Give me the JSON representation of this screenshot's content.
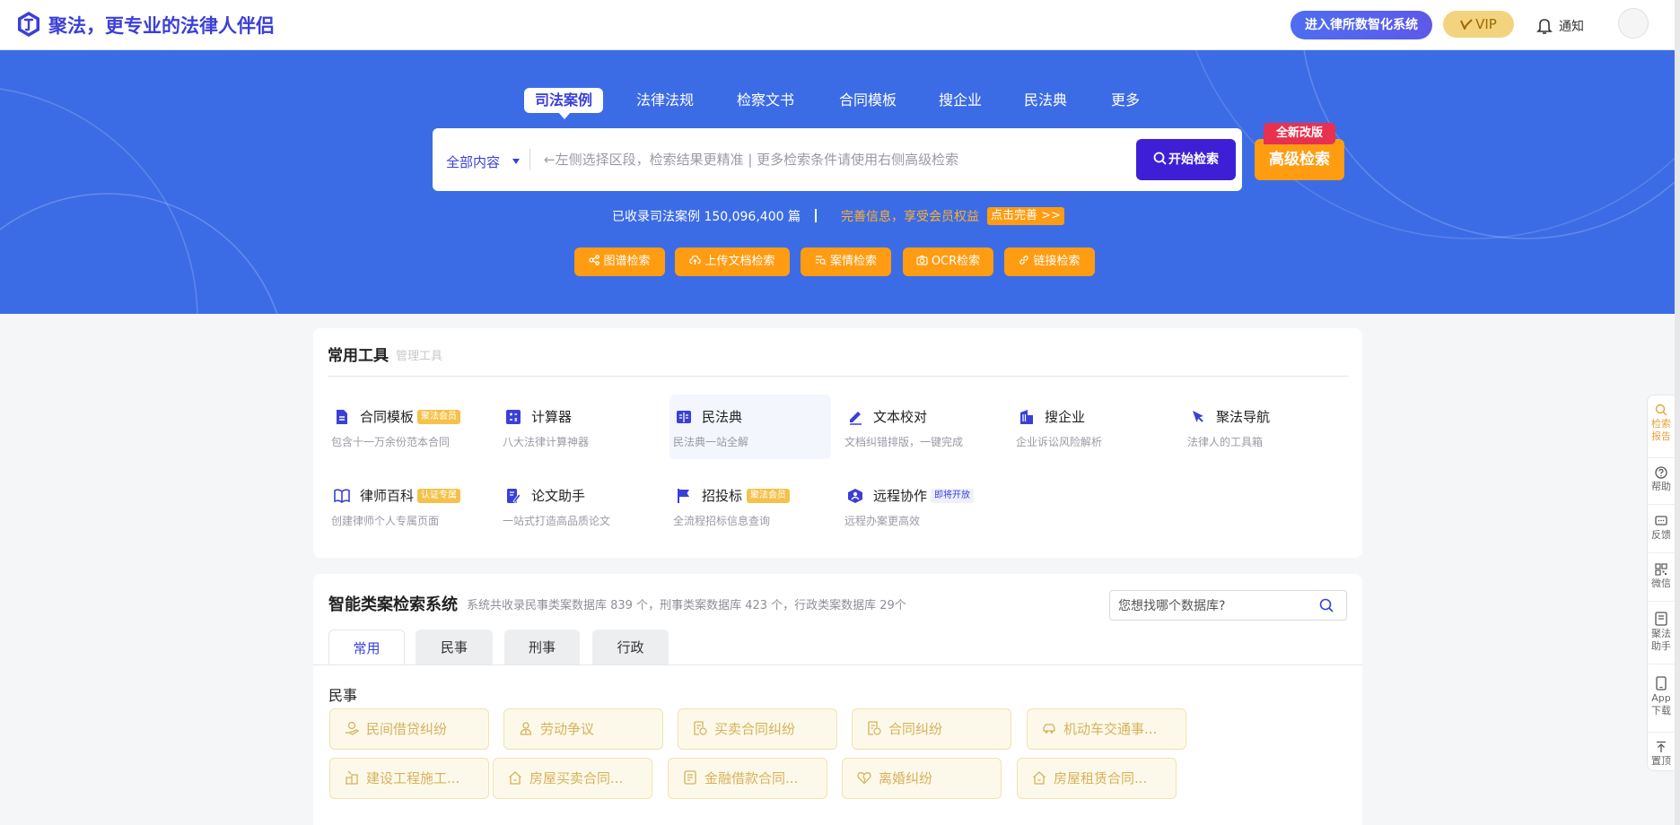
{
  "header": {
    "slogan": "聚法，更专业的法律人伴侣",
    "enter_system": "进入律所数智化系统",
    "vip": "VIP",
    "notify": "通知"
  },
  "nav_tabs": [
    "司法案例",
    "法律法规",
    "检察文书",
    "合同模板",
    "搜企业",
    "民法典",
    "更多"
  ],
  "search": {
    "scope": "全部内容",
    "placeholder": "←左侧选择区段，检索结果更精准 | 更多检索条件请使用右侧高级检索",
    "start": "开始检索",
    "advanced": "高级检索",
    "new_badge": "全新改版"
  },
  "stats": {
    "count_text": "已收录司法案例 150,096,400 篇",
    "perfect_text": "完善信息，享受会员权益",
    "perfect_btn": "点击完善 >>"
  },
  "quick_search": [
    "图谱检索",
    "上传文档检索",
    "案情检索",
    "OCR检索",
    "链接检索"
  ],
  "tools": {
    "title": "常用工具",
    "manage": "管理工具",
    "items": [
      {
        "name": "合同模板",
        "desc": "包含十一万余份范本合同",
        "badge": "聚法会员"
      },
      {
        "name": "计算器",
        "desc": "八大法律计算神器",
        "badge": ""
      },
      {
        "name": "民法典",
        "desc": "民法典一站全解",
        "badge": ""
      },
      {
        "name": "文本校对",
        "desc": "文档纠错排版，一键完成",
        "badge": ""
      },
      {
        "name": "搜企业",
        "desc": "企业诉讼风险解析",
        "badge": ""
      },
      {
        "name": "聚法导航",
        "desc": "法律人的工具箱",
        "badge": ""
      },
      {
        "name": "律师百科",
        "desc": "创建律师个人专属页面",
        "badge": "认证专属"
      },
      {
        "name": "论文助手",
        "desc": "一站式打造高品质论文",
        "badge": ""
      },
      {
        "name": "招投标",
        "desc": "全流程招标信息查询",
        "badge": "聚法会员"
      },
      {
        "name": "远程协作",
        "desc": "远程办案更高效",
        "badge": "即将开放"
      }
    ]
  },
  "cases": {
    "title": "智能类案检索系统",
    "subtitle": "系统共收录民事类案数据库 839 个，刑事类案数据库 423 个，行政类案数据库 29个",
    "db_placeholder": "您想找哪个数据库?",
    "tabs": [
      "常用",
      "民事",
      "刑事",
      "行政"
    ],
    "section": "民事",
    "chips": [
      "民间借贷纠纷",
      "劳动争议",
      "买卖合同纠纷",
      "合同纠纷",
      "机动车交通事...",
      "建设工程施工...",
      "房屋买卖合同...",
      "金融借款合同...",
      "离婚纠纷",
      "房屋租赁合同..."
    ]
  },
  "side_bar": [
    "检索报告",
    "帮助",
    "反馈",
    "微信",
    "聚法助手",
    "App下载",
    "置顶"
  ],
  "colors": {
    "primary": "#3b3fd8",
    "hero_bg": "#3c6ce5",
    "accent_orange": "#ff9c12",
    "badge_red": "#e8304f"
  }
}
